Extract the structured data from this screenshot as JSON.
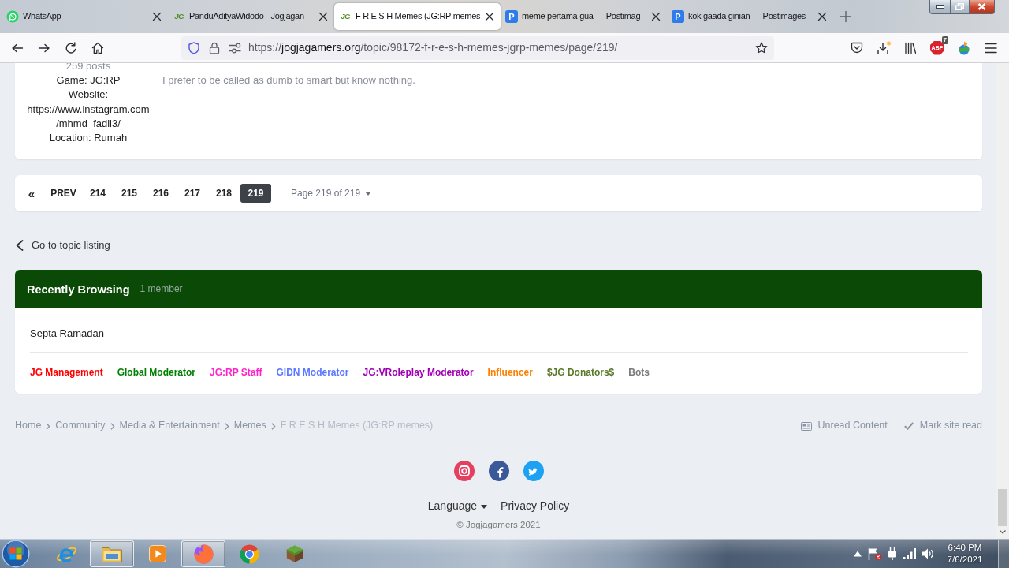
{
  "browser": {
    "tabs": [
      {
        "title": "WhatsApp",
        "kind": "whatsapp",
        "selected": false
      },
      {
        "title": "PanduAdityaWidodo - Jogjagan",
        "kind": "jg",
        "logo": "JG",
        "selected": false
      },
      {
        "title": "F R E S H Memes (JG:RP memes",
        "kind": "jg",
        "logo": "JG",
        "selected": true
      },
      {
        "title": "meme pertama gua — Postimag",
        "kind": "postimages",
        "logo": "P",
        "selected": false
      },
      {
        "title": "kok gaada ginian — Postimages",
        "kind": "postimages",
        "logo": "P",
        "selected": false
      }
    ],
    "address": {
      "scheme": "https://",
      "host": "jogjagamers.org",
      "path": "/topic/98172-f-r-e-s-h-memes-jgrp-memes/page/219/"
    },
    "adblock": {
      "label": "ABP",
      "count": "7"
    }
  },
  "post": {
    "posts": "259 posts",
    "details": [
      "Game: JG:RP",
      "Website:",
      "https://www.instagram.com",
      "/mhmd_fadli3/",
      "Location: Rumah"
    ],
    "signature": "I prefer to be called as dumb to smart but know nothing."
  },
  "pagination": {
    "first": "«",
    "prev": "PREV",
    "pages": [
      {
        "label": "214",
        "selected": false
      },
      {
        "label": "215",
        "selected": false
      },
      {
        "label": "216",
        "selected": false
      },
      {
        "label": "217",
        "selected": false
      },
      {
        "label": "218",
        "selected": false
      },
      {
        "label": "219",
        "selected": true
      }
    ],
    "jump": "Page 219 of 219"
  },
  "back_link": "Go to topic listing",
  "recently_browsing": {
    "title": "Recently Browsing",
    "count": "1 member",
    "members": [
      "Septa Ramadan"
    ],
    "groups": [
      {
        "name": "JG Management",
        "color": "#ff0000"
      },
      {
        "name": "Global Moderator",
        "color": "#008000"
      },
      {
        "name": "JG:RP Staff",
        "color": "#ff22c8"
      },
      {
        "name": "GIDN Moderator",
        "color": "#5a78ff"
      },
      {
        "name": "JG:VRoleplay Moderator",
        "color": "#a000b4"
      },
      {
        "name": "Influencer",
        "color": "#ff7f00"
      },
      {
        "name": "$JG Donators$",
        "color": "#5a7a2a"
      },
      {
        "name": "Bots",
        "color": "#7a7a7a"
      }
    ]
  },
  "breadcrumb": {
    "items": [
      "Home",
      "Community",
      "Media & Entertainment",
      "Memes",
      "F R E S H Memes (JG:RP memes)"
    ],
    "actions": [
      {
        "label": "Unread Content",
        "kind": "unread"
      },
      {
        "label": "Mark site read",
        "kind": "mark-read"
      }
    ]
  },
  "footer": {
    "links": [
      {
        "label": "Language",
        "kind": "menu"
      },
      {
        "label": "Privacy Policy",
        "kind": "link"
      }
    ],
    "copyright": "© Jogjagamers 2021"
  },
  "taskbar": {
    "apps": [
      {
        "kind": "ie",
        "running": false
      },
      {
        "kind": "explorer",
        "running": true
      },
      {
        "kind": "media-player",
        "running": false
      },
      {
        "kind": "firefox",
        "running": true
      },
      {
        "kind": "chrome",
        "running": false
      },
      {
        "kind": "minecraft",
        "running": false
      }
    ],
    "time": "6:40 PM",
    "date": "7/6/2021"
  }
}
